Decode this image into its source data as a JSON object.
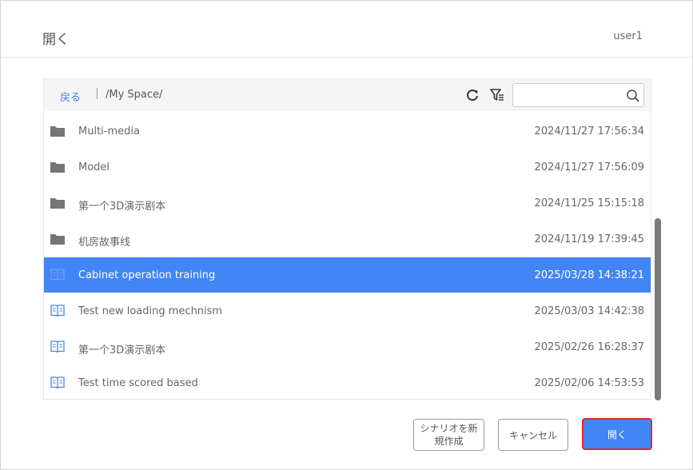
{
  "dialog": {
    "title": "開く",
    "user": "user1"
  },
  "toolbar": {
    "back_label": "戻る",
    "path": "/My Space/",
    "search_value": "",
    "refresh_icon": "refresh-icon",
    "filter_icon": "filter-icon",
    "search_icon": "search-icon"
  },
  "files": [
    {
      "name": "Multi-media",
      "date": "2024/11/27 17:56:34",
      "type": "folder",
      "selected": false
    },
    {
      "name": "Model",
      "date": "2024/11/27 17:56:09",
      "type": "folder",
      "selected": false
    },
    {
      "name": "第一个3D演示剧本",
      "date": "2024/11/25 15:15:18",
      "type": "folder",
      "selected": false
    },
    {
      "name": "机房故事线",
      "date": "2024/11/19 17:39:45",
      "type": "folder",
      "selected": false
    },
    {
      "name": "Cabinet operation training",
      "date": "2025/03/28 14:38:21",
      "type": "scenario",
      "selected": true
    },
    {
      "name": "Test new loading mechnism",
      "date": "2025/03/03 14:42:38",
      "type": "scenario",
      "selected": false
    },
    {
      "name": "第一个3D演示剧本",
      "date": "2025/02/26 16:28:37",
      "type": "scenario",
      "selected": false
    },
    {
      "name": "Test time scored based",
      "date": "2025/02/06 14:53:53",
      "type": "scenario",
      "selected": false
    }
  ],
  "buttons": {
    "new_scenario": "シナリオを新規作成",
    "cancel": "キャンセル",
    "open": "開く"
  },
  "colors": {
    "accent": "#4285f4",
    "highlight_border": "#e0282e",
    "folder_icon": "#757575",
    "scenario_icon": "#4a86e8"
  }
}
